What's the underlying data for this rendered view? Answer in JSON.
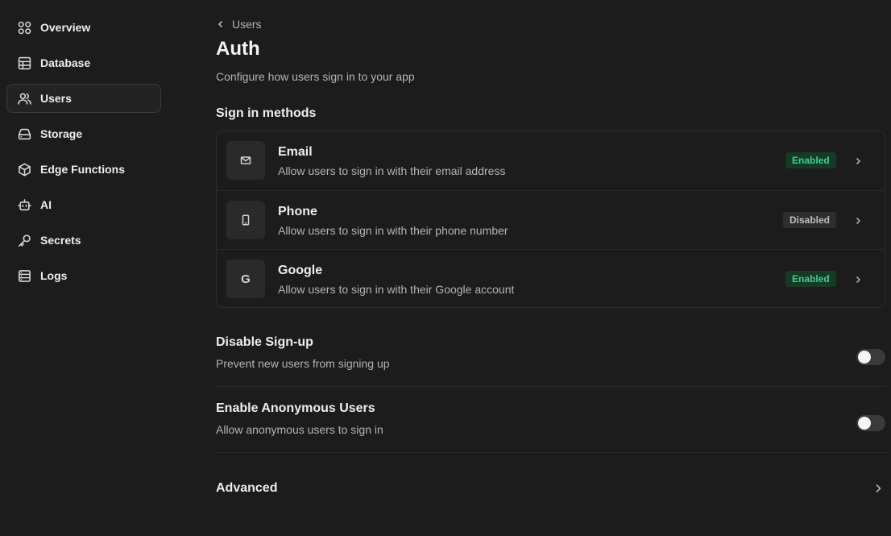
{
  "sidebar": {
    "items": [
      {
        "label": "Overview",
        "icon": "grid-icon"
      },
      {
        "label": "Database",
        "icon": "table-icon"
      },
      {
        "label": "Users",
        "icon": "users-icon",
        "active": true
      },
      {
        "label": "Storage",
        "icon": "hard-drive-icon"
      },
      {
        "label": "Edge Functions",
        "icon": "box-icon"
      },
      {
        "label": "AI",
        "icon": "bot-icon"
      },
      {
        "label": "Secrets",
        "icon": "key-icon"
      },
      {
        "label": "Logs",
        "icon": "list-icon"
      }
    ]
  },
  "header": {
    "breadcrumb": "Users",
    "title": "Auth",
    "subtitle": "Configure how users sign in to your app"
  },
  "sign_in": {
    "section_title": "Sign in methods",
    "methods": [
      {
        "name": "Email",
        "description": "Allow users to sign in with their email address",
        "status": "Enabled",
        "icon": "mail-icon"
      },
      {
        "name": "Phone",
        "description": "Allow users to sign in with their phone number",
        "status": "Disabled",
        "icon": "smartphone-icon"
      },
      {
        "name": "Google",
        "description": "Allow users to sign in with their Google account",
        "status": "Enabled",
        "icon": "google-icon",
        "glyph": "G"
      }
    ]
  },
  "settings": {
    "disable_signup": {
      "title": "Disable Sign-up",
      "description": "Prevent new users from signing up",
      "enabled": false
    },
    "anonymous_users": {
      "title": "Enable Anonymous Users",
      "description": "Allow anonymous users to sign in",
      "enabled": false
    }
  },
  "advanced": {
    "title": "Advanced"
  },
  "colors": {
    "background": "#1c1c1c",
    "enabled_badge_bg": "#163a25",
    "enabled_badge_text": "#3ecf8e",
    "disabled_badge_bg": "#2e2e2e"
  }
}
